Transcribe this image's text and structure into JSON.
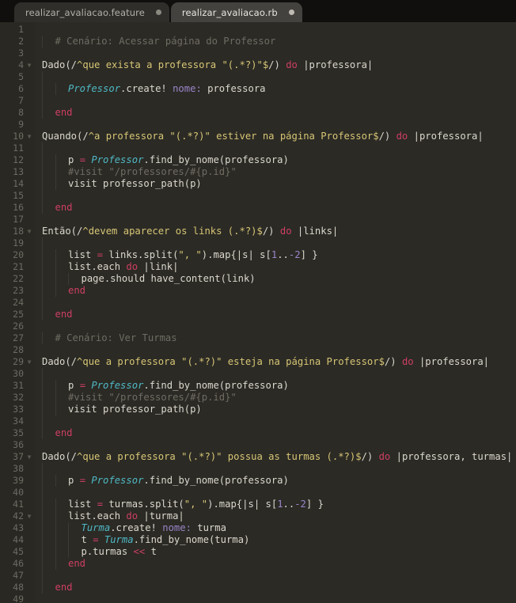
{
  "window": {
    "kind": "code-editor",
    "background": "#2b2a25",
    "gutter_background": "#292822",
    "tabbar_background": "#100f0d"
  },
  "tabbar": {
    "tabs": [
      {
        "label": "realizar_avaliacao.feature",
        "active": false,
        "modified_dot": true
      },
      {
        "label": "realizar_avaliacao.rb",
        "active": true,
        "modified_dot": true
      }
    ]
  },
  "editor": {
    "language": "Ruby",
    "colors": {
      "text": "#dcd8cd",
      "comment": "#6f6c62",
      "keyword": "#cf3f62",
      "constant": "#4fb8c4",
      "string": "#d7c675",
      "symbol": "#9a85c9",
      "number": "#9a85c9",
      "line_number": "#6d6b63",
      "indent_guide": "#3b3a34"
    },
    "first_line_number": 1,
    "last_line_number": 49,
    "lines": [
      {
        "n": 1,
        "fold": false,
        "indent": 0,
        "tokens": []
      },
      {
        "n": 2,
        "fold": false,
        "indent": 1,
        "tokens": [
          {
            "t": "com",
            "s": "# Cenário: Acessar página do Professor"
          }
        ]
      },
      {
        "n": 3,
        "fold": false,
        "indent": 0,
        "tokens": []
      },
      {
        "n": 4,
        "fold": true,
        "indent": 0,
        "tokens": [
          {
            "t": "plain",
            "s": "Dado(/"
          },
          {
            "t": "str",
            "s": "^que exista a professora \"(.*?)\"$"
          },
          {
            "t": "plain",
            "s": "/) "
          },
          {
            "t": "kw",
            "s": "do"
          },
          {
            "t": "plain",
            "s": " |professora|"
          }
        ]
      },
      {
        "n": 5,
        "fold": false,
        "indent": 1,
        "tokens": []
      },
      {
        "n": 6,
        "fold": false,
        "indent": 2,
        "tokens": [
          {
            "t": "const",
            "s": "Professor"
          },
          {
            "t": "plain",
            "s": ".create! "
          },
          {
            "t": "sym",
            "s": "nome:"
          },
          {
            "t": "plain",
            "s": " professora"
          }
        ]
      },
      {
        "n": 7,
        "fold": false,
        "indent": 1,
        "tokens": []
      },
      {
        "n": 8,
        "fold": false,
        "indent": 1,
        "tokens": [
          {
            "t": "kw",
            "s": "end"
          }
        ]
      },
      {
        "n": 9,
        "fold": false,
        "indent": 0,
        "tokens": []
      },
      {
        "n": 10,
        "fold": true,
        "indent": 0,
        "tokens": [
          {
            "t": "plain",
            "s": "Quando(/"
          },
          {
            "t": "str",
            "s": "^a professora \"(.*?)\" estiver na página Professor$"
          },
          {
            "t": "plain",
            "s": "/) "
          },
          {
            "t": "kw",
            "s": "do"
          },
          {
            "t": "plain",
            "s": " |professora|"
          }
        ]
      },
      {
        "n": 11,
        "fold": false,
        "indent": 1,
        "tokens": []
      },
      {
        "n": 12,
        "fold": false,
        "indent": 2,
        "tokens": [
          {
            "t": "plain",
            "s": "p "
          },
          {
            "t": "op",
            "s": "="
          },
          {
            "t": "plain",
            "s": " "
          },
          {
            "t": "const",
            "s": "Professor"
          },
          {
            "t": "plain",
            "s": ".find_by_nome(professora)"
          }
        ]
      },
      {
        "n": 13,
        "fold": false,
        "indent": 2,
        "tokens": [
          {
            "t": "com",
            "s": "#visit \"/professores/#{p.id}\""
          }
        ]
      },
      {
        "n": 14,
        "fold": false,
        "indent": 2,
        "tokens": [
          {
            "t": "plain",
            "s": "visit professor_path(p)"
          }
        ]
      },
      {
        "n": 15,
        "fold": false,
        "indent": 1,
        "tokens": []
      },
      {
        "n": 16,
        "fold": false,
        "indent": 1,
        "tokens": [
          {
            "t": "kw",
            "s": "end"
          }
        ]
      },
      {
        "n": 17,
        "fold": false,
        "indent": 0,
        "tokens": []
      },
      {
        "n": 18,
        "fold": true,
        "indent": 0,
        "tokens": [
          {
            "t": "plain",
            "s": "Então(/"
          },
          {
            "t": "str",
            "s": "^devem aparecer os links (.*?)$"
          },
          {
            "t": "plain",
            "s": "/) "
          },
          {
            "t": "kw",
            "s": "do"
          },
          {
            "t": "plain",
            "s": " |links|"
          }
        ]
      },
      {
        "n": 19,
        "fold": false,
        "indent": 1,
        "tokens": []
      },
      {
        "n": 20,
        "fold": false,
        "indent": 2,
        "tokens": [
          {
            "t": "plain",
            "s": "list "
          },
          {
            "t": "op",
            "s": "="
          },
          {
            "t": "plain",
            "s": " links.split("
          },
          {
            "t": "str",
            "s": "\", \""
          },
          {
            "t": "plain",
            "s": ").map{|s| s["
          },
          {
            "t": "num",
            "s": "1"
          },
          {
            "t": "plain",
            "s": ".."
          },
          {
            "t": "num",
            "s": "-2"
          },
          {
            "t": "plain",
            "s": "] }"
          }
        ]
      },
      {
        "n": 21,
        "fold": false,
        "indent": 2,
        "tokens": [
          {
            "t": "plain",
            "s": "list.each "
          },
          {
            "t": "kw",
            "s": "do"
          },
          {
            "t": "plain",
            "s": " |link|"
          }
        ]
      },
      {
        "n": 22,
        "fold": false,
        "indent": 3,
        "tokens": [
          {
            "t": "plain",
            "s": "page.should have_content(link)"
          }
        ]
      },
      {
        "n": 23,
        "fold": false,
        "indent": 2,
        "tokens": [
          {
            "t": "kw",
            "s": "end"
          }
        ]
      },
      {
        "n": 24,
        "fold": false,
        "indent": 1,
        "tokens": []
      },
      {
        "n": 25,
        "fold": false,
        "indent": 1,
        "tokens": [
          {
            "t": "kw",
            "s": "end"
          }
        ]
      },
      {
        "n": 26,
        "fold": false,
        "indent": 0,
        "tokens": []
      },
      {
        "n": 27,
        "fold": false,
        "indent": 1,
        "tokens": [
          {
            "t": "com",
            "s": "# Cenário: Ver Turmas"
          }
        ]
      },
      {
        "n": 28,
        "fold": false,
        "indent": 0,
        "tokens": []
      },
      {
        "n": 29,
        "fold": true,
        "indent": 0,
        "tokens": [
          {
            "t": "plain",
            "s": "Dado(/"
          },
          {
            "t": "str",
            "s": "^que a professora \"(.*?)\" esteja na página Professor$"
          },
          {
            "t": "plain",
            "s": "/) "
          },
          {
            "t": "kw",
            "s": "do"
          },
          {
            "t": "plain",
            "s": " |professora|"
          }
        ]
      },
      {
        "n": 30,
        "fold": false,
        "indent": 1,
        "tokens": []
      },
      {
        "n": 31,
        "fold": false,
        "indent": 2,
        "tokens": [
          {
            "t": "plain",
            "s": "p "
          },
          {
            "t": "op",
            "s": "="
          },
          {
            "t": "plain",
            "s": " "
          },
          {
            "t": "const",
            "s": "Professor"
          },
          {
            "t": "plain",
            "s": ".find_by_nome(professora)"
          }
        ]
      },
      {
        "n": 32,
        "fold": false,
        "indent": 2,
        "tokens": [
          {
            "t": "com",
            "s": "#visit \"/professores/#{p.id}\""
          }
        ]
      },
      {
        "n": 33,
        "fold": false,
        "indent": 2,
        "tokens": [
          {
            "t": "plain",
            "s": "visit professor_path(p)"
          }
        ]
      },
      {
        "n": 34,
        "fold": false,
        "indent": 1,
        "tokens": []
      },
      {
        "n": 35,
        "fold": false,
        "indent": 1,
        "tokens": [
          {
            "t": "kw",
            "s": "end"
          }
        ]
      },
      {
        "n": 36,
        "fold": false,
        "indent": 0,
        "tokens": []
      },
      {
        "n": 37,
        "fold": true,
        "indent": 0,
        "tokens": [
          {
            "t": "plain",
            "s": "Dado(/"
          },
          {
            "t": "str",
            "s": "^que a professora \"(.*?)\" possua as turmas (.*?)$"
          },
          {
            "t": "plain",
            "s": "/) "
          },
          {
            "t": "kw",
            "s": "do"
          },
          {
            "t": "plain",
            "s": " |professora, turmas|"
          }
        ]
      },
      {
        "n": 38,
        "fold": false,
        "indent": 1,
        "tokens": []
      },
      {
        "n": 39,
        "fold": false,
        "indent": 2,
        "tokens": [
          {
            "t": "plain",
            "s": "p "
          },
          {
            "t": "op",
            "s": "="
          },
          {
            "t": "plain",
            "s": " "
          },
          {
            "t": "const",
            "s": "Professor"
          },
          {
            "t": "plain",
            "s": ".find_by_nome(professora)"
          }
        ]
      },
      {
        "n": 40,
        "fold": false,
        "indent": 1,
        "tokens": []
      },
      {
        "n": 41,
        "fold": false,
        "indent": 2,
        "tokens": [
          {
            "t": "plain",
            "s": "list "
          },
          {
            "t": "op",
            "s": "="
          },
          {
            "t": "plain",
            "s": " turmas.split("
          },
          {
            "t": "str",
            "s": "\", \""
          },
          {
            "t": "plain",
            "s": ").map{|s| s["
          },
          {
            "t": "num",
            "s": "1"
          },
          {
            "t": "plain",
            "s": ".."
          },
          {
            "t": "num",
            "s": "-2"
          },
          {
            "t": "plain",
            "s": "] }"
          }
        ]
      },
      {
        "n": 42,
        "fold": true,
        "indent": 2,
        "tokens": [
          {
            "t": "plain",
            "s": "list.each "
          },
          {
            "t": "kw",
            "s": "do"
          },
          {
            "t": "plain",
            "s": " |turma|"
          }
        ]
      },
      {
        "n": 43,
        "fold": false,
        "indent": 3,
        "tokens": [
          {
            "t": "const",
            "s": "Turma"
          },
          {
            "t": "plain",
            "s": ".create! "
          },
          {
            "t": "sym",
            "s": "nome:"
          },
          {
            "t": "plain",
            "s": " turma"
          }
        ]
      },
      {
        "n": 44,
        "fold": false,
        "indent": 3,
        "tokens": [
          {
            "t": "plain",
            "s": "t "
          },
          {
            "t": "op",
            "s": "="
          },
          {
            "t": "plain",
            "s": " "
          },
          {
            "t": "const",
            "s": "Turma"
          },
          {
            "t": "plain",
            "s": ".find_by_nome(turma)"
          }
        ]
      },
      {
        "n": 45,
        "fold": false,
        "indent": 3,
        "tokens": [
          {
            "t": "plain",
            "s": "p.turmas "
          },
          {
            "t": "op",
            "s": "<<"
          },
          {
            "t": "plain",
            "s": " t"
          }
        ]
      },
      {
        "n": 46,
        "fold": false,
        "indent": 2,
        "tokens": [
          {
            "t": "kw",
            "s": "end"
          }
        ]
      },
      {
        "n": 47,
        "fold": false,
        "indent": 1,
        "tokens": []
      },
      {
        "n": 48,
        "fold": false,
        "indent": 1,
        "tokens": [
          {
            "t": "kw",
            "s": "end"
          }
        ]
      },
      {
        "n": 49,
        "fold": false,
        "indent": 0,
        "tokens": []
      }
    ]
  }
}
